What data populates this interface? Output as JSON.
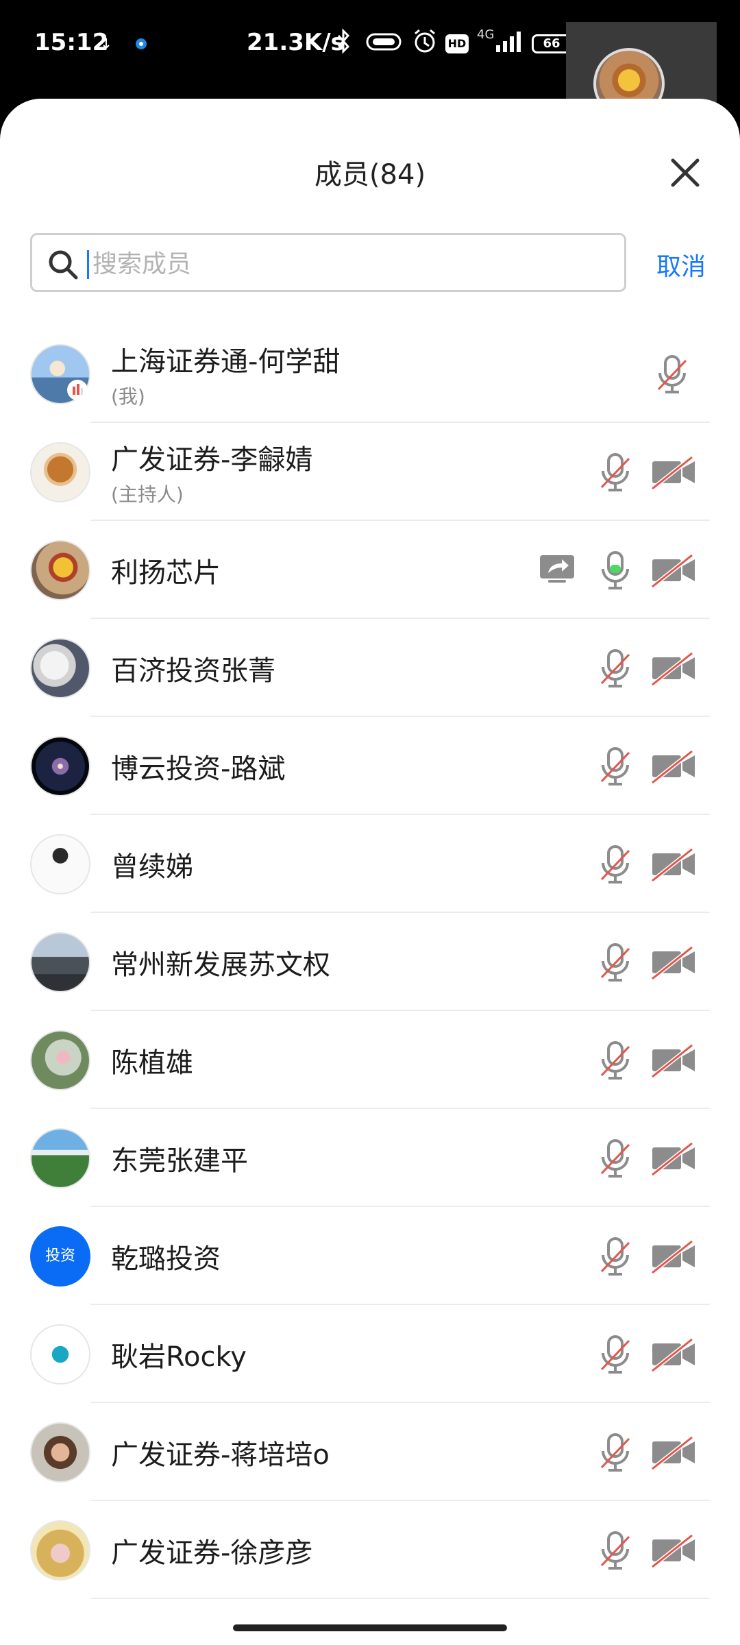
{
  "status_bar": {
    "time": "15:12",
    "speed": "21.3K/s",
    "network": "4G",
    "hd": "HD",
    "battery": "66"
  },
  "panel": {
    "title": "成员(84)",
    "search_placeholder": "搜索成员",
    "cancel_label": "取消"
  },
  "colors": {
    "accent": "#1677ff",
    "muted_red": "#e2564b",
    "speaking_green": "#4cd964",
    "icon_gray": "#8c8c8c"
  },
  "members": [
    {
      "name": "上海证券通-何学甜",
      "role": "(我)",
      "mic": "muted",
      "camera": "none",
      "share": false,
      "avatar": "photo-beach"
    },
    {
      "name": "广发证券-李龣婧",
      "role": "(主持人)",
      "mic": "muted",
      "camera": "off",
      "share": false,
      "avatar": "photo-food"
    },
    {
      "name": "利扬芯片",
      "role": "",
      "mic": "speaking",
      "camera": "off",
      "share": true,
      "avatar": "photo-pooh"
    },
    {
      "name": "百济投资张菁",
      "role": "",
      "mic": "muted",
      "camera": "off",
      "share": false,
      "avatar": "photo-cat"
    },
    {
      "name": "博云投资-路斌",
      "role": "",
      "mic": "muted",
      "camera": "off",
      "share": false,
      "avatar": "photo-galaxy"
    },
    {
      "name": "曾续娣",
      "role": "",
      "mic": "muted",
      "camera": "off",
      "share": false,
      "avatar": "photo-sketch"
    },
    {
      "name": "常州新发展苏文权",
      "role": "",
      "mic": "muted",
      "camera": "off",
      "share": false,
      "avatar": "photo-cars"
    },
    {
      "name": "陈植雄",
      "role": "",
      "mic": "muted",
      "camera": "off",
      "share": false,
      "avatar": "photo-child"
    },
    {
      "name": "东莞张建平",
      "role": "",
      "mic": "muted",
      "camera": "off",
      "share": false,
      "avatar": "photo-mountain"
    },
    {
      "name": "乾璐投资",
      "role": "",
      "mic": "muted",
      "camera": "off",
      "share": false,
      "avatar": "text",
      "avatar_text": "投资"
    },
    {
      "name": "耿岩Rocky",
      "role": "",
      "mic": "muted",
      "camera": "off",
      "share": false,
      "avatar": "photo-bike"
    },
    {
      "name": "广发证券-蒋培培o",
      "role": "",
      "mic": "muted",
      "camera": "off",
      "share": false,
      "avatar": "photo-woman"
    },
    {
      "name": "广发证券-徐彦彦",
      "role": "",
      "mic": "muted",
      "camera": "off",
      "share": false,
      "avatar": "photo-toy"
    }
  ]
}
